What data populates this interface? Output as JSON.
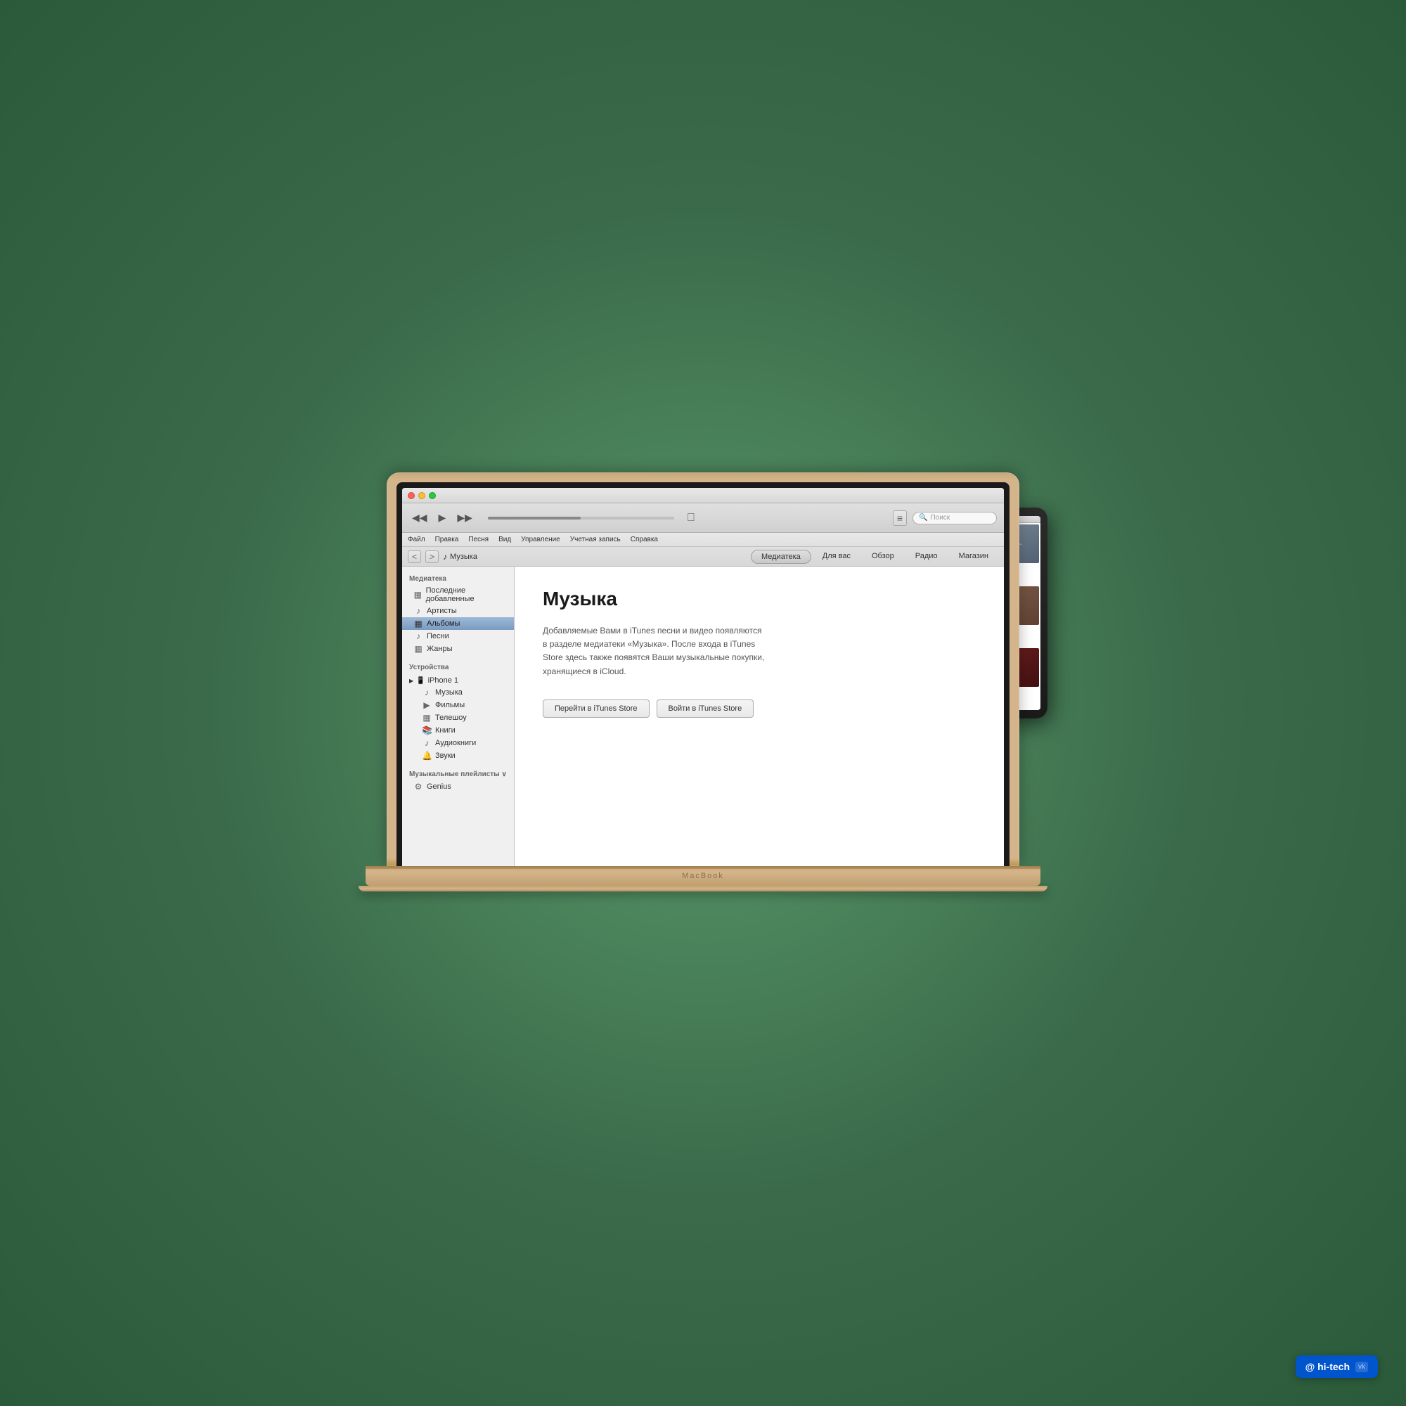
{
  "macbook": {
    "label": "MacBook"
  },
  "window": {
    "title_bar": {
      "close": "×",
      "minimize": "–",
      "maximize": "+"
    }
  },
  "toolbar": {
    "rewind": "◀◀",
    "play": "▶",
    "forward": "▶▶",
    "list_view": "≡",
    "search_placeholder": "Поиск"
  },
  "menu": {
    "items": [
      "Файл",
      "Правка",
      "Песня",
      "Вид",
      "Управление",
      "Учетная запись",
      "Справка"
    ]
  },
  "nav": {
    "back": "<",
    "forward": ">",
    "location_icon": "♪",
    "location": "Музыка",
    "tabs": [
      "Медиатека",
      "Для вас",
      "Обзор",
      "Радио",
      "Магазин"
    ]
  },
  "sidebar": {
    "library_header": "Медиатека",
    "library_items": [
      {
        "icon": "▦",
        "label": "Последние добавленные"
      },
      {
        "icon": "♪",
        "label": "Артисты"
      },
      {
        "icon": "▦",
        "label": "Альбомы",
        "active": true
      },
      {
        "icon": "♪",
        "label": "Песни"
      },
      {
        "icon": "▦",
        "label": "Жанры"
      }
    ],
    "devices_header": "Устройства",
    "device_name": "iPhone 1",
    "device_items": [
      {
        "icon": "♪",
        "label": "Музыка"
      },
      {
        "icon": "▶",
        "label": "Фильмы"
      },
      {
        "icon": "▦",
        "label": "Телешоу"
      },
      {
        "icon": "📚",
        "label": "Книги"
      },
      {
        "icon": "♪",
        "label": "Аудиокниги"
      },
      {
        "icon": "🔔",
        "label": "Звуки"
      }
    ],
    "playlists_header": "Музыкальные плейлисты ∨",
    "playlist_items": [
      {
        "icon": "⚙",
        "label": "Genius"
      }
    ]
  },
  "content": {
    "title": "Музыка",
    "description": "Добавляемые Вами в iTunes песни и видео появляются в разделе медиатеки «Музыка». После входа в iTunes Store здесь также появятся Ваши музыкальные покупки, хранящиеся в iCloud.",
    "btn_store": "Перейти в iTunes Store",
    "btn_login": "Войти в iTunes Store"
  },
  "hitech": {
    "logo": "@ hi-tech",
    "vk": "vk"
  }
}
